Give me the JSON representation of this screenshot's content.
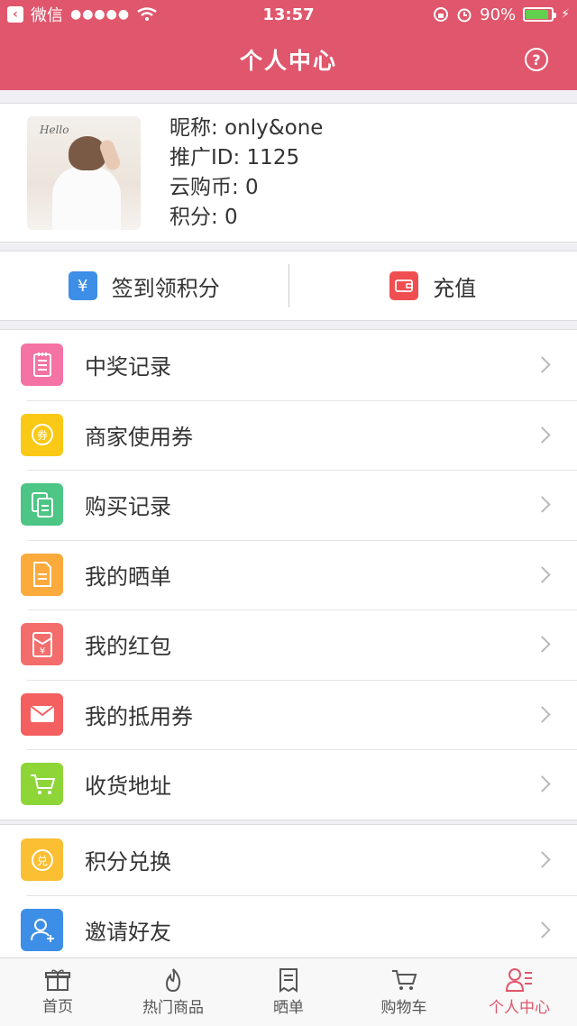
{
  "status_bar": {
    "carrier": "微信",
    "signal": "●●●●●",
    "time": "13:57",
    "battery_percent_text": "90%",
    "battery_level": 0.9
  },
  "nav": {
    "title": "个人中心",
    "help_icon": "question-circle-icon"
  },
  "profile": {
    "nickname": "昵称: only&one",
    "promo_id": "推广ID: 1125",
    "coins": "云购币: 0",
    "points": "积分: 0",
    "avatar_text": "Hello"
  },
  "actions": [
    {
      "label": "签到领积分",
      "icon": "yen-icon",
      "color": "#3d8ee6"
    },
    {
      "label": "充值",
      "icon": "wallet-icon",
      "color": "#f04f52"
    }
  ],
  "menu1": [
    {
      "label": "中奖记录",
      "icon": "notepad-icon",
      "color": "#f472a4"
    },
    {
      "label": "商家使用券",
      "icon": "coupon-circle-icon",
      "color": "#fac916"
    },
    {
      "label": "购买记录",
      "icon": "documents-icon",
      "color": "#4cc585"
    },
    {
      "label": "我的晒单",
      "icon": "document-icon",
      "color": "#fbaa3b"
    },
    {
      "label": "我的红包",
      "icon": "red-packet-icon",
      "color": "#f36d6d"
    },
    {
      "label": "我的抵用券",
      "icon": "envelope-icon",
      "color": "#f45f5f"
    },
    {
      "label": "收货地址",
      "icon": "cart-icon",
      "color": "#8ed538"
    }
  ],
  "menu2": [
    {
      "label": "积分兑换",
      "icon": "exchange-icon",
      "color": "#fbbf33"
    },
    {
      "label": "邀请好友",
      "icon": "add-user-icon",
      "color": "#3d8ee6"
    }
  ],
  "tabs": [
    {
      "label": "首页",
      "icon": "gift-icon"
    },
    {
      "label": "热门商品",
      "icon": "flame-icon"
    },
    {
      "label": "晒单",
      "icon": "receipt-icon"
    },
    {
      "label": "购物车",
      "icon": "cart-icon"
    },
    {
      "label": "个人中心",
      "icon": "user-list-icon",
      "active": true
    }
  ]
}
